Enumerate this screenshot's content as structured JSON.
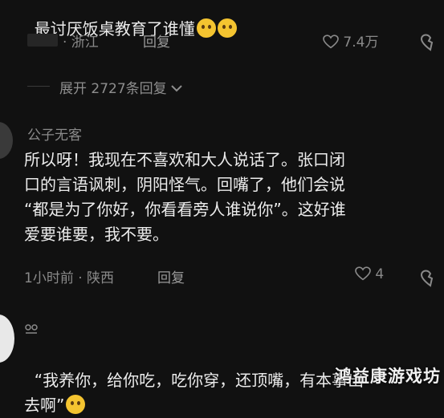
{
  "comment1": {
    "text": "最讨厌饭桌教育了谁懂",
    "location": "· 浙江",
    "reply": "回复",
    "likes": "7.4万"
  },
  "expand": {
    "label": "展开 2727条回复"
  },
  "comment2": {
    "username": "公子无客",
    "text": "所以呀！我现在不喜欢和大人说话了。张口闭\n口的言语讽刺，阴阳怪气。回嘴了，他们会说\n“都是为了你好，你看看旁人谁说你”。这好谁\n爱要谁要，我不要。",
    "meta": "1小时前 · 陕西",
    "reply": "回复",
    "likes": "4"
  },
  "comment3": {
    "text": "“我养你，给你吃，吃你穿，还顶嘴，有本事出\n去啊”"
  },
  "watermark": "鸿益康游戏坊"
}
